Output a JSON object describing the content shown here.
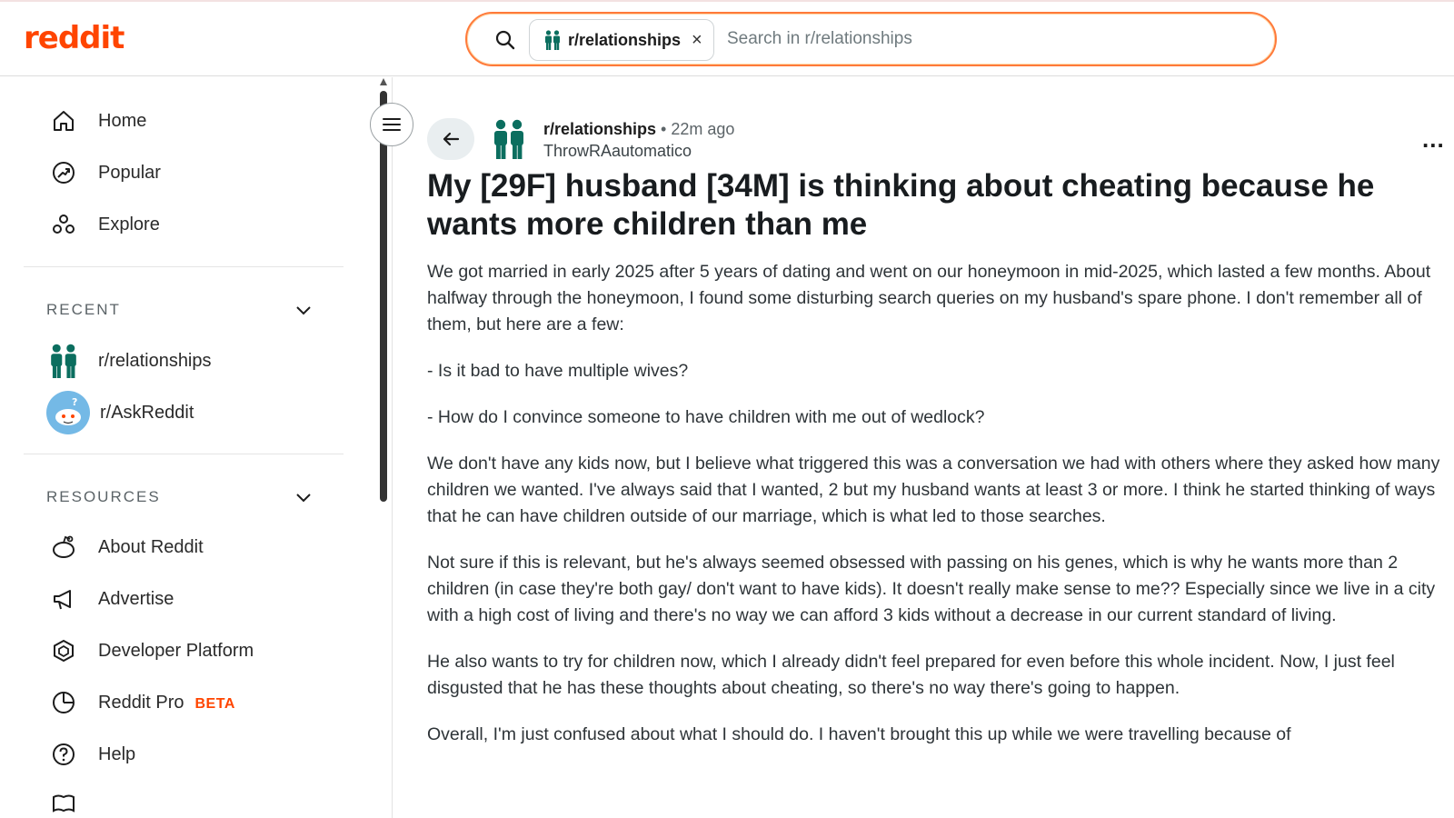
{
  "header": {
    "logo": "reddit",
    "search": {
      "chip_label": "r/relationships",
      "chip_close": "×",
      "placeholder": "Search in r/relationships"
    }
  },
  "sidebar": {
    "nav": [
      {
        "label": "Home",
        "icon": "home-icon"
      },
      {
        "label": "Popular",
        "icon": "popular-icon"
      },
      {
        "label": "Explore",
        "icon": "explore-icon"
      }
    ],
    "recent": {
      "title": "RECENT",
      "items": [
        {
          "label": "r/relationships",
          "icon": "relationships-community-icon"
        },
        {
          "label": "r/AskReddit",
          "icon": "askreddit-community-icon"
        }
      ]
    },
    "resources": {
      "title": "RESOURCES",
      "items": [
        {
          "label": "About Reddit",
          "icon": "about-reddit-icon"
        },
        {
          "label": "Advertise",
          "icon": "megaphone-icon"
        },
        {
          "label": "Developer Platform",
          "icon": "developer-platform-icon"
        },
        {
          "label": "Reddit Pro",
          "badge": "BETA",
          "icon": "reddit-pro-icon"
        },
        {
          "label": "Help",
          "icon": "help-icon"
        }
      ]
    }
  },
  "post": {
    "subreddit": "r/relationships",
    "time": "22m ago",
    "separator": "•",
    "author": "ThrowRAautomatico",
    "more": "...",
    "title": "My [29F] husband [34M] is thinking about cheating because he wants more children than me",
    "paragraphs": [
      "We got married in early 2025 after 5 years of dating and went on our honeymoon in mid-2025, which lasted a few months. About halfway through the honeymoon, I found some disturbing search queries on my husband's spare phone. I don't remember all of them, but here are a few:",
      "- Is it bad to have multiple wives?",
      "- How do I convince someone to have children with me out of wedlock?",
      "We don't have any kids now, but I believe what triggered this was a conversation we had with others where they asked how many children we wanted. I've always said that I wanted, 2 but my husband wants at least 3 or more. I think he started thinking of ways that he can have children outside of our marriage, which is what led to those searches.",
      "Not sure if this is relevant, but he's always seemed obsessed with passing on his genes, which is why he wants more than 2 children (in case they're both gay/ don't want to have kids). It doesn't really make sense to me?? Especially since we live in a city with a high cost of living and there's no way we can afford 3 kids without a decrease in our current standard of living.",
      "He also wants to try for children now, which I already didn't feel prepared for even before this whole incident. Now, I just feel disgusted that he has these thoughts about cheating, so there's no way there's going to happen.",
      "Overall, I'm just confused about what I should do. I haven't brought this up while we were travelling because of"
    ]
  },
  "colors": {
    "brand": "#ff4500",
    "community_teal": "#0b6e5f"
  }
}
